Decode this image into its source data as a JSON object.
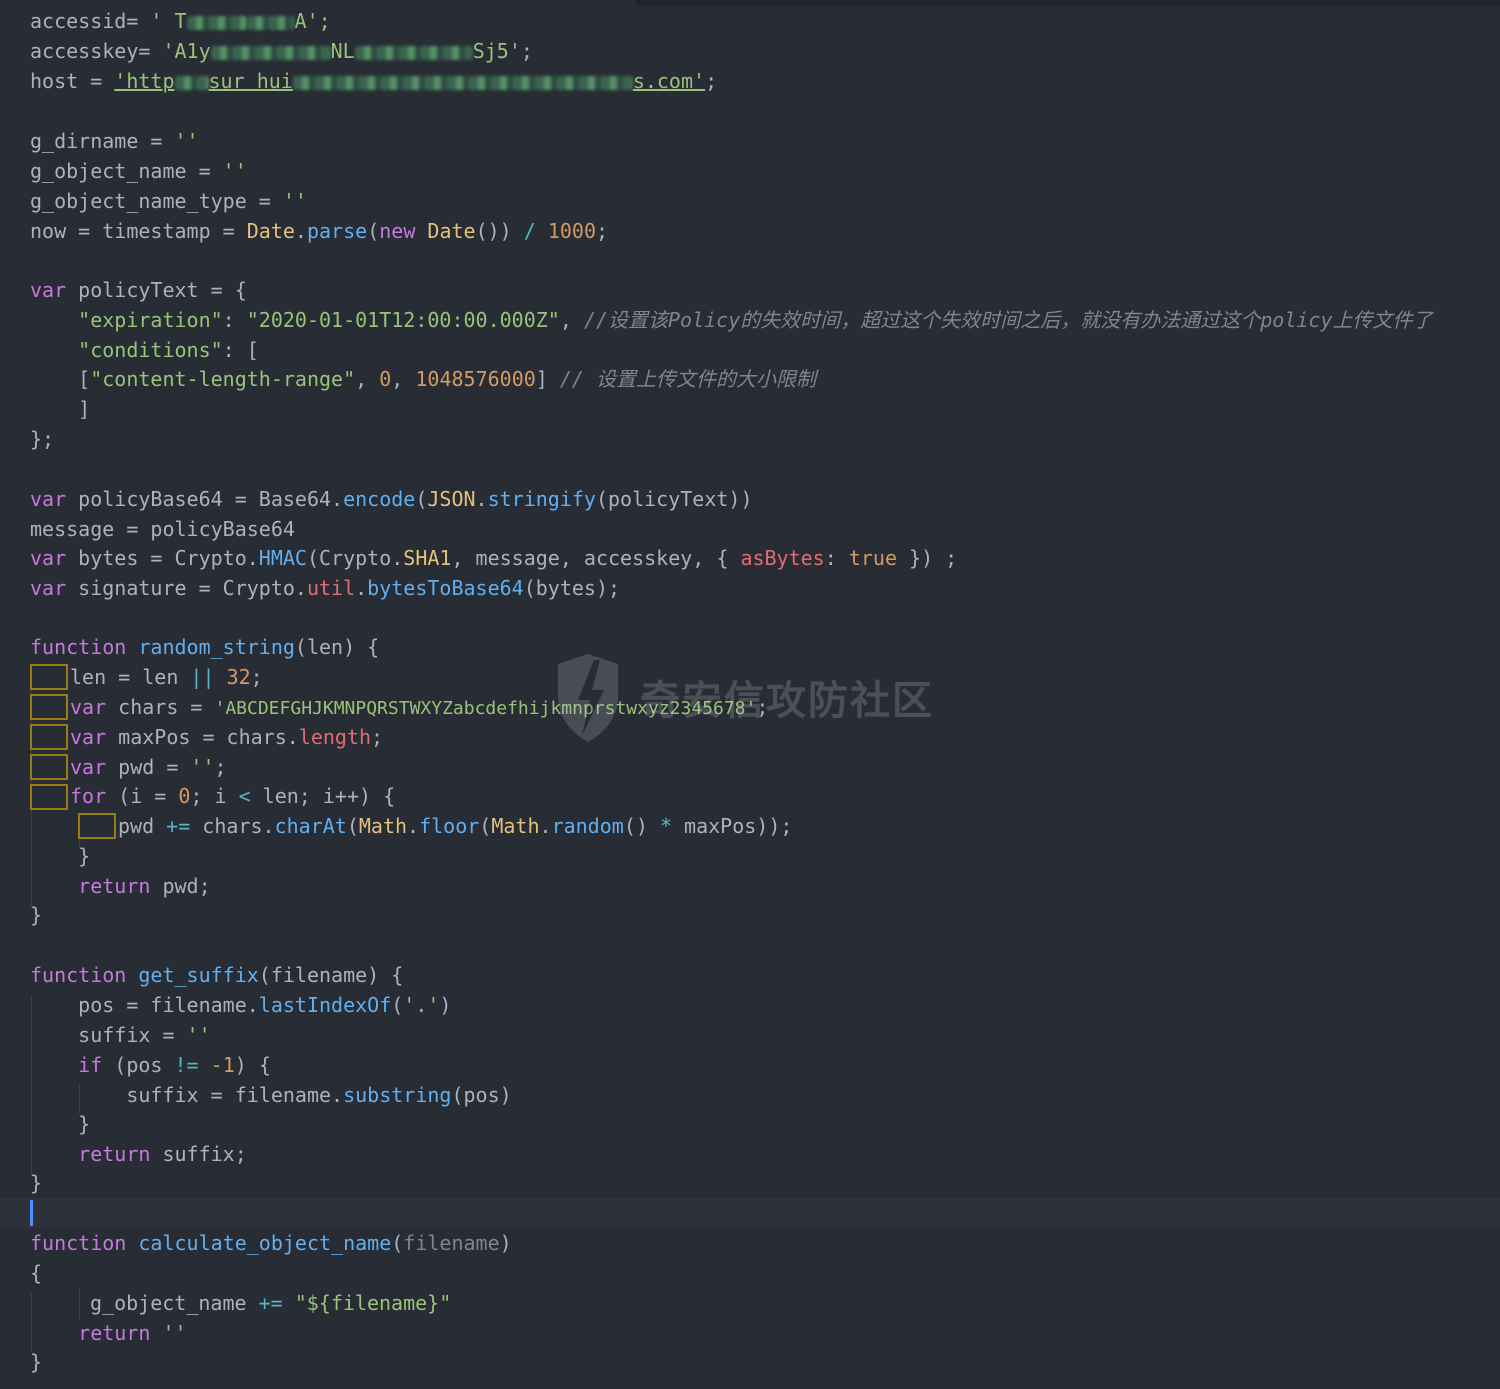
{
  "editor": {
    "theme_colors": {
      "background": "#282c34",
      "keyword": "#c678dd",
      "function": "#61afef",
      "string": "#98c379",
      "number": "#d19a66",
      "class": "#e5c07b",
      "property": "#e06c75",
      "comment": "#7f848e",
      "cursor": "#528bff"
    },
    "watermark": {
      "text": "奇安信攻防社区",
      "icon": "shield-lightning-icon"
    }
  },
  "code": {
    "l1": {
      "a": "accessid= ",
      "b": "' T",
      "c": "A';"
    },
    "l2": {
      "a": "accesskey= ",
      "b": "'A1y",
      "c": "NL",
      "d": "Sj5'",
      "e": ";"
    },
    "l3": {
      "a": "host = ",
      "b": "'http",
      "c": "sur",
      "d": "hui",
      "e": "s.com'",
      "f": ";"
    },
    "l5": {
      "a": "g_dirname = ",
      "b": "''"
    },
    "l6": {
      "a": "g_object_name = ",
      "b": "''"
    },
    "l7": {
      "a": "g_object_name_type = ",
      "b": "''"
    },
    "l8": {
      "a": "now = timestamp = ",
      "b": "Date",
      "c": ".",
      "d": "parse",
      "e": "(",
      "f": "new",
      "g": " Date",
      "h": "()) ",
      "i": "/",
      "j": " ",
      "k": "1000",
      "l": ";"
    },
    "l10": {
      "a": "var",
      "b": " policyText = {"
    },
    "l11": {
      "a": "    ",
      "b": "\"expiration\"",
      "c": ": ",
      "d": "\"2020-01-01T12:00:00.000Z\"",
      "e": ", ",
      "f": "//设置该Policy的失效时间，超过这个失效时间之后，就没有办法通过这个policy上传文件了"
    },
    "l12": {
      "a": "    ",
      "b": "\"conditions\"",
      "c": ": ["
    },
    "l13": {
      "a": "    [",
      "b": "\"content-length-range\"",
      "c": ", ",
      "d": "0",
      "e": ", ",
      "f": "1048576000",
      "g": "] ",
      "h": "// 设置上传文件的大小限制"
    },
    "l14": {
      "a": "    ]"
    },
    "l15": {
      "a": "};"
    },
    "l17": {
      "a": "var",
      "b": " policyBase64 = Base64.",
      "c": "encode",
      "d": "(",
      "e": "JSON",
      "f": ".",
      "g": "stringify",
      "h": "(policyText))"
    },
    "l18": {
      "a": "message = policyBase64"
    },
    "l19": {
      "a": "var",
      "b": " bytes = Crypto.",
      "c": "HMAC",
      "d": "(Crypto.",
      "e": "SHA1",
      "f": ", message, accesskey, { ",
      "g": "asBytes",
      "h": ": ",
      "i": "true",
      "j": " }) ;"
    },
    "l20": {
      "a": "var",
      "b": " signature = Crypto.",
      "c": "util",
      "d": ".",
      "e": "bytesToBase64",
      "f": "(bytes);"
    },
    "l22": {
      "a": "function",
      "b": " ",
      "c": "random_string",
      "d": "(len) {"
    },
    "l23": {
      "a": "len = len ",
      "b": "||",
      "c": " ",
      "d": "32",
      "e": ";"
    },
    "l24": {
      "a": "var",
      "b": " chars = ",
      "c": "'ABCDEFGHJKMNPQRSTWXYZabcdefhijkmnprstwxyz2345678'",
      "d": ";"
    },
    "l25": {
      "a": "var",
      "b": " maxPos = chars.",
      "c": "length",
      "d": ";"
    },
    "l26": {
      "a": "var",
      "b": " pwd = ",
      "c": "''",
      "d": ";"
    },
    "l27": {
      "a": "for",
      "b": " (i = ",
      "c": "0",
      "d": "; i ",
      "e": "<",
      "f": " len; i++) {"
    },
    "l28": {
      "a": "pwd ",
      "b": "+=",
      "c": " chars.",
      "d": "charAt",
      "e": "(",
      "f": "Math",
      "g": ".",
      "h": "floor",
      "i": "(",
      "j": "Math",
      "k": ".",
      "l": "random",
      "m": "() ",
      "n": "*",
      "o": " maxPos));"
    },
    "l29": {
      "a": "    }"
    },
    "l30": {
      "a": "    ",
      "b": "return",
      "c": " pwd;"
    },
    "l31": {
      "a": "}"
    },
    "l33": {
      "a": "function",
      "b": " ",
      "c": "get_suffix",
      "d": "(filename) {"
    },
    "l34": {
      "a": "    pos = filename.",
      "b": "lastIndexOf",
      "c": "(",
      "d": "'.'",
      "e": ")"
    },
    "l35": {
      "a": "    suffix = ",
      "b": "''"
    },
    "l36": {
      "a": "    ",
      "b": "if",
      "c": " (pos ",
      "d": "!=",
      "e": " ",
      "f": "-1",
      "g": ") {"
    },
    "l37": {
      "a": "        suffix = filename.",
      "b": "substring",
      "c": "(pos)"
    },
    "l38": {
      "a": "    }"
    },
    "l39": {
      "a": "    ",
      "b": "return",
      "c": " suffix;"
    },
    "l40": {
      "a": "}"
    },
    "l42": {
      "a": "function",
      "b": " ",
      "c": "calculate_object_name",
      "d": "(",
      "e": "filename",
      "f": ")"
    },
    "l43": {
      "a": "{"
    },
    "l44": {
      "a": "g_object_name ",
      "b": "+=",
      "c": " ",
      "d": "\"${filename}\""
    },
    "l45": {
      "a": "    ",
      "b": "return",
      "c": " ",
      "d": "''"
    },
    "l46": {
      "a": "}"
    }
  }
}
